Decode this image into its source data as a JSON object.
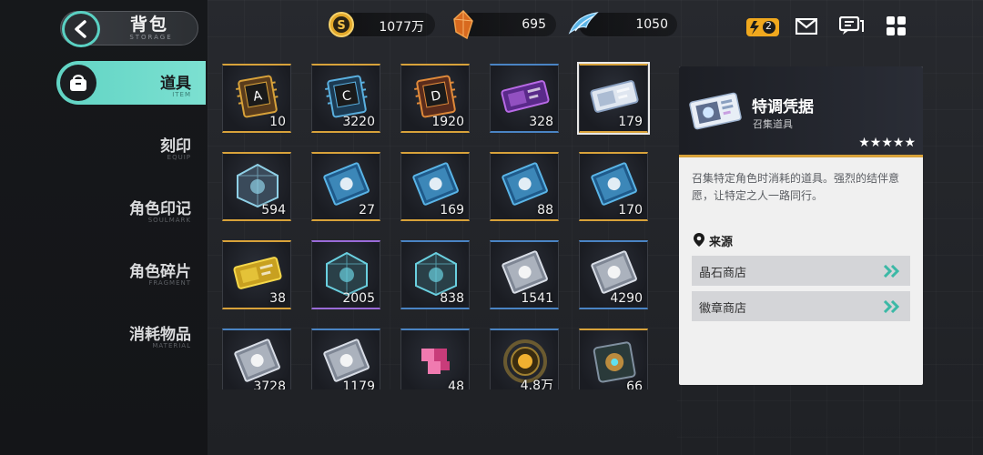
{
  "header": {
    "title": "背包",
    "subtitle": "STORAGE"
  },
  "currencies": [
    {
      "icon": "coin-icon",
      "value": "1077万"
    },
    {
      "icon": "crystal-shard-icon",
      "value": "695"
    },
    {
      "icon": "stamina-wing-icon",
      "value": "1050"
    }
  ],
  "topbar": {
    "battery_badge": "2"
  },
  "nav": {
    "items": [
      {
        "label": "道具",
        "sub": "ITEM",
        "active": true
      },
      {
        "label": "刻印",
        "sub": "EQUIP"
      },
      {
        "label": "角色印记",
        "sub": "SOULMARK"
      },
      {
        "label": "角色碎片",
        "sub": "FRAGMENT"
      },
      {
        "label": "消耗物品",
        "sub": "MATERIAL"
      }
    ]
  },
  "items": [
    {
      "count": "10",
      "rarity": "gold",
      "icon": "chip-a-icon"
    },
    {
      "count": "3220",
      "rarity": "gold",
      "icon": "chip-c-icon"
    },
    {
      "count": "1920",
      "rarity": "gold",
      "icon": "chip-d-icon"
    },
    {
      "count": "328",
      "rarity": "blue",
      "icon": "purple-ticket-icon"
    },
    {
      "count": "179",
      "rarity": "gold",
      "icon": "summon-ticket-icon",
      "selected": true
    },
    {
      "count": "594",
      "rarity": "gold",
      "icon": "crystal-cube-icon"
    },
    {
      "count": "27",
      "rarity": "gold",
      "icon": "blue-book-icon"
    },
    {
      "count": "169",
      "rarity": "gold",
      "icon": "blue-book-atom-icon"
    },
    {
      "count": "88",
      "rarity": "gold",
      "icon": "blue-book-drop-icon"
    },
    {
      "count": "170",
      "rarity": "gold",
      "icon": "blue-book-swirl-icon"
    },
    {
      "count": "38",
      "rarity": "gold",
      "icon": "gold-ticket-icon"
    },
    {
      "count": "2005",
      "rarity": "purple",
      "icon": "teal-cube-icon"
    },
    {
      "count": "838",
      "rarity": "blue",
      "icon": "teal-cube-small-icon"
    },
    {
      "count": "1541",
      "rarity": "blue",
      "icon": "white-book-icon"
    },
    {
      "count": "4290",
      "rarity": "blue",
      "icon": "white-book-atom-icon"
    },
    {
      "count": "3728",
      "rarity": "blue",
      "icon": "white-book-drop-icon"
    },
    {
      "count": "1179",
      "rarity": "blue",
      "icon": "white-book-swirl-icon"
    },
    {
      "count": "48",
      "rarity": "blue",
      "icon": "pink-puzzle-icon"
    },
    {
      "count": "4.8万",
      "rarity": "blue",
      "icon": "gold-orb-icon"
    },
    {
      "count": "66",
      "rarity": "gold",
      "icon": "rainbow-core-icon"
    }
  ],
  "detail": {
    "name": "特调凭据",
    "type": "召集道具",
    "stars": "★★★★★",
    "description": "召集特定角色时消耗的道具。强烈的结伴意愿，让特定之人一路同行。",
    "source_title": "来源",
    "sources": [
      {
        "label": "晶石商店"
      },
      {
        "label": "徽章商店"
      }
    ]
  },
  "colors": {
    "accent": "#61d4c4",
    "gold_rarity": "#d8a23a",
    "purple_rarity": "#9a6bd8",
    "blue_rarity": "#4a84c4"
  }
}
